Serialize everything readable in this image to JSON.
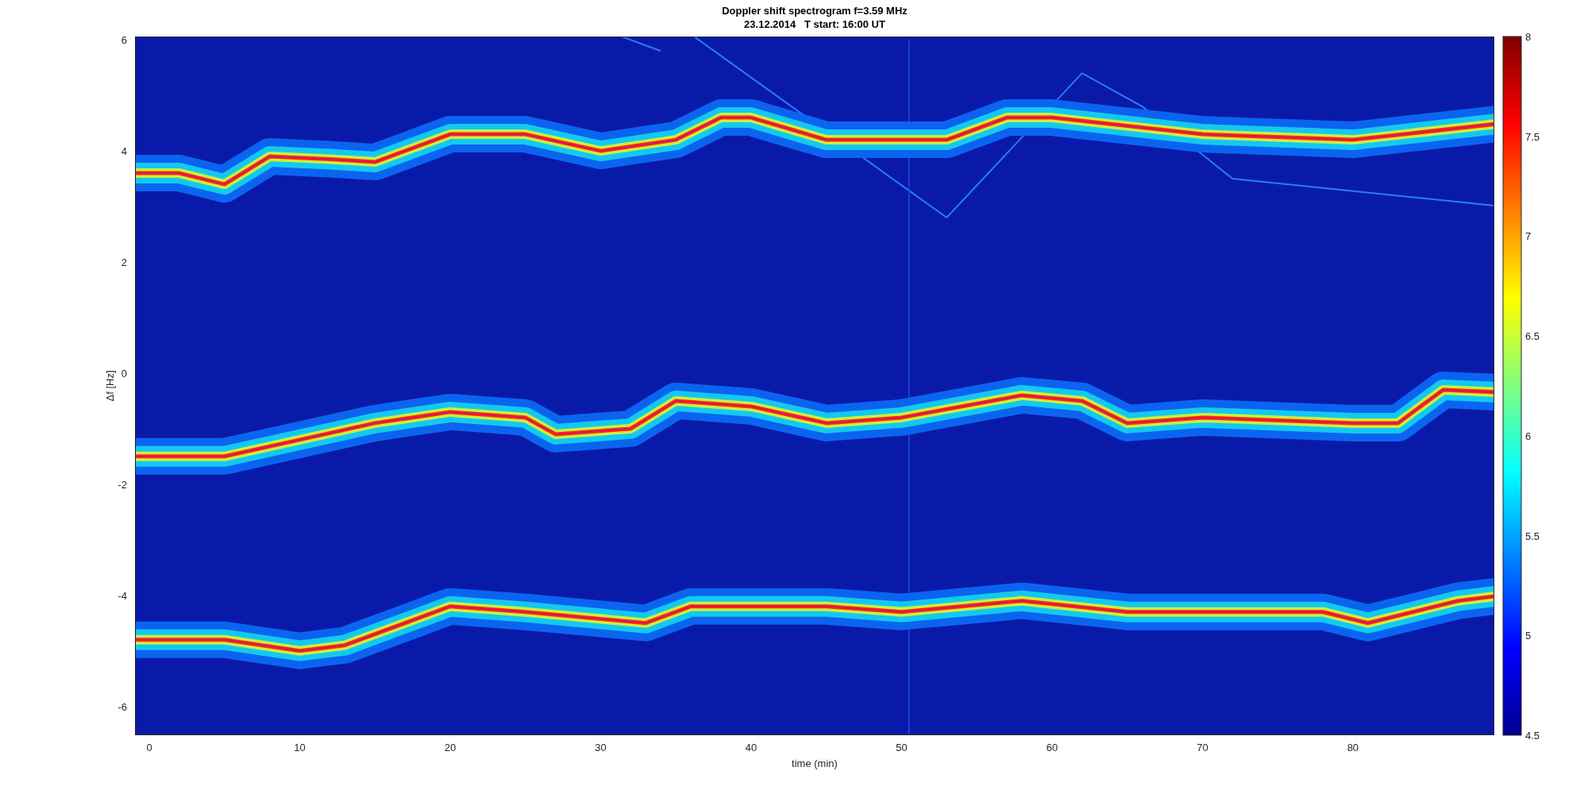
{
  "figure": {
    "title": [
      "Doppler shift spectrogram f=3.59 MHz",
      "23.12.2014   T start: 16:00 UT"
    ]
  },
  "axes": {
    "xlabel": "time (min)",
    "ylabel": "Δf [Hz]",
    "xticks": [
      "0",
      "10",
      "20",
      "30",
      "40",
      "50",
      "60",
      "70",
      "80"
    ],
    "yticks": [
      "6",
      "4",
      "2",
      "0",
      "-2",
      "-4",
      "-6"
    ]
  },
  "colorbar": {
    "ticks": [
      "8",
      "7.5",
      "7",
      "6.5",
      "6",
      "5.5",
      "5",
      "4.5"
    ]
  }
}
